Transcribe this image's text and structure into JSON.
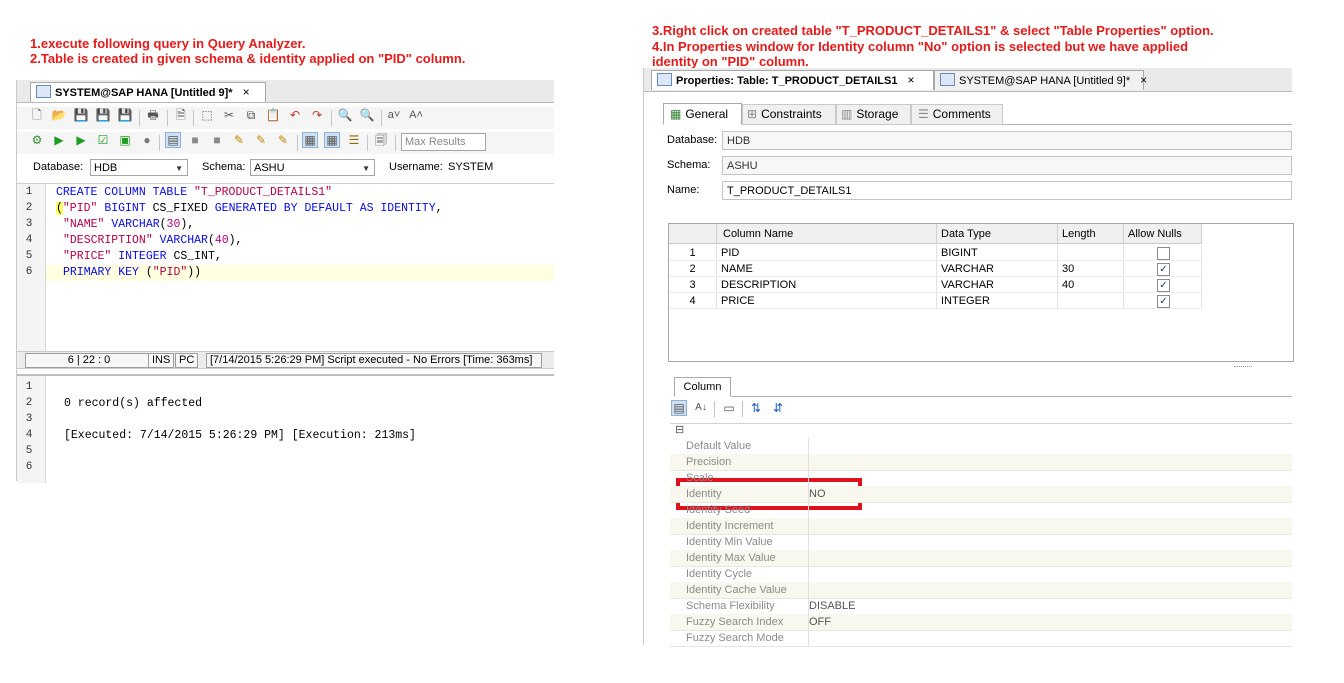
{
  "notes": {
    "left_line1": "1.execute following query in Query Analyzer.",
    "left_line2": "2.Table is created in given schema & identity applied on \"PID\" column.",
    "right_line1": "3.Right click on created table \"T_PRODUCT_DETAILS1\" & select \"Table Properties\" option.",
    "right_line2": "4.In Properties window for Identity column \"No\" option is selected but we have applied",
    "right_line3": "identity on \"PID\" column."
  },
  "colors": {
    "note_red": "#e31b1b",
    "highlight_red": "#e0101c",
    "keyword": "#0a0ae6",
    "string": "#b5004b"
  },
  "sql_editor": {
    "tab_title": "SYSTEM@SAP HANA [Untitled 9]*",
    "tab_close": "×",
    "max_results_placeholder": "Max Results",
    "database_label": "Database:",
    "database_value": "HDB",
    "schema_label": "Schema:",
    "schema_value": "ASHU",
    "username_label": "Username:",
    "username_value": "SYSTEM",
    "line_numbers": [
      "1",
      "2",
      "3",
      "4",
      "5",
      "6"
    ],
    "code": [
      {
        "kw1": "CREATE COLUMN TABLE ",
        "s1": "\"T_PRODUCT_DETAILS1\""
      },
      {
        "p1": "(",
        "s1": "\"PID\"",
        "kw1": " BIGINT ",
        "t1": "CS_FIXED ",
        "kw2": "GENERATED BY DEFAULT AS IDENTITY",
        "t2": ","
      },
      {
        "s1": "\"NAME\"",
        "kw1": " VARCHAR",
        "t1": "(",
        "n1": "30",
        "t2": "),"
      },
      {
        "s1": "\"DESCRIPTION\"",
        "kw1": " VARCHAR",
        "t1": "(",
        "n1": "40",
        "t2": "),"
      },
      {
        "s1": "\"PRICE\"",
        "kw1": " INTEGER ",
        "t1": "CS_INT,"
      },
      {
        "kw1": "PRIMARY KEY ",
        "t1": "(",
        "s1": "\"PID\"",
        "t2": "))"
      }
    ],
    "status": {
      "position": "6 | 22 : 0",
      "mode": "INS",
      "pc": "PC",
      "message": "[7/14/2015 5:26:29 PM] Script executed - No Errors [Time: 363ms]"
    },
    "output_line_numbers": [
      "1",
      "2",
      "3",
      "4",
      "5",
      "6"
    ],
    "output_lines": [
      "",
      "0 record(s) affected",
      "",
      "[Executed: 7/14/2015 5:26:29 PM] [Execution: 213ms]",
      "",
      ""
    ]
  },
  "properties": {
    "tab_title": "Properties: Table: T_PRODUCT_DETAILS1",
    "tab_close": "×",
    "other_tab_title": "SYSTEM@SAP HANA [Untitled 9]*",
    "other_tab_close": "×",
    "subtabs": [
      "General",
      "Constraints",
      "Storage",
      "Comments"
    ],
    "database_label": "Database:",
    "database_value": "HDB",
    "schema_label": "Schema:",
    "schema_value": "ASHU",
    "name_label": "Name:",
    "name_value": "T_PRODUCT_DETAILS1",
    "columns_headers": [
      "Column Name",
      "Data Type",
      "Length",
      "Allow Nulls"
    ],
    "columns": [
      {
        "num": "1",
        "name": "PID",
        "type": "BIGINT",
        "length": "",
        "nulls": false
      },
      {
        "num": "2",
        "name": "NAME",
        "type": "VARCHAR",
        "length": "30",
        "nulls": true
      },
      {
        "num": "3",
        "name": "DESCRIPTION",
        "type": "VARCHAR",
        "length": "40",
        "nulls": true
      },
      {
        "num": "4",
        "name": "PRICE",
        "type": "INTEGER",
        "length": "",
        "nulls": true
      }
    ],
    "check_glyph": "✓",
    "column_tab": "Column",
    "collapse_glyph": "⊟",
    "props": [
      {
        "name": "Default Value",
        "value": ""
      },
      {
        "name": "Precision",
        "value": ""
      },
      {
        "name": "Scale",
        "value": ""
      },
      {
        "name": "Identity",
        "value": "NO"
      },
      {
        "name": "Identity Seed",
        "value": ""
      },
      {
        "name": "Identity Increment",
        "value": ""
      },
      {
        "name": "Identity Min Value",
        "value": ""
      },
      {
        "name": "Identity Max Value",
        "value": ""
      },
      {
        "name": "Identity Cycle",
        "value": ""
      },
      {
        "name": "Identity Cache Value",
        "value": ""
      },
      {
        "name": "Schema Flexibility",
        "value": "DISABLE"
      },
      {
        "name": "Fuzzy Search Index",
        "value": "OFF"
      },
      {
        "name": "Fuzzy Search Mode",
        "value": ""
      }
    ]
  }
}
